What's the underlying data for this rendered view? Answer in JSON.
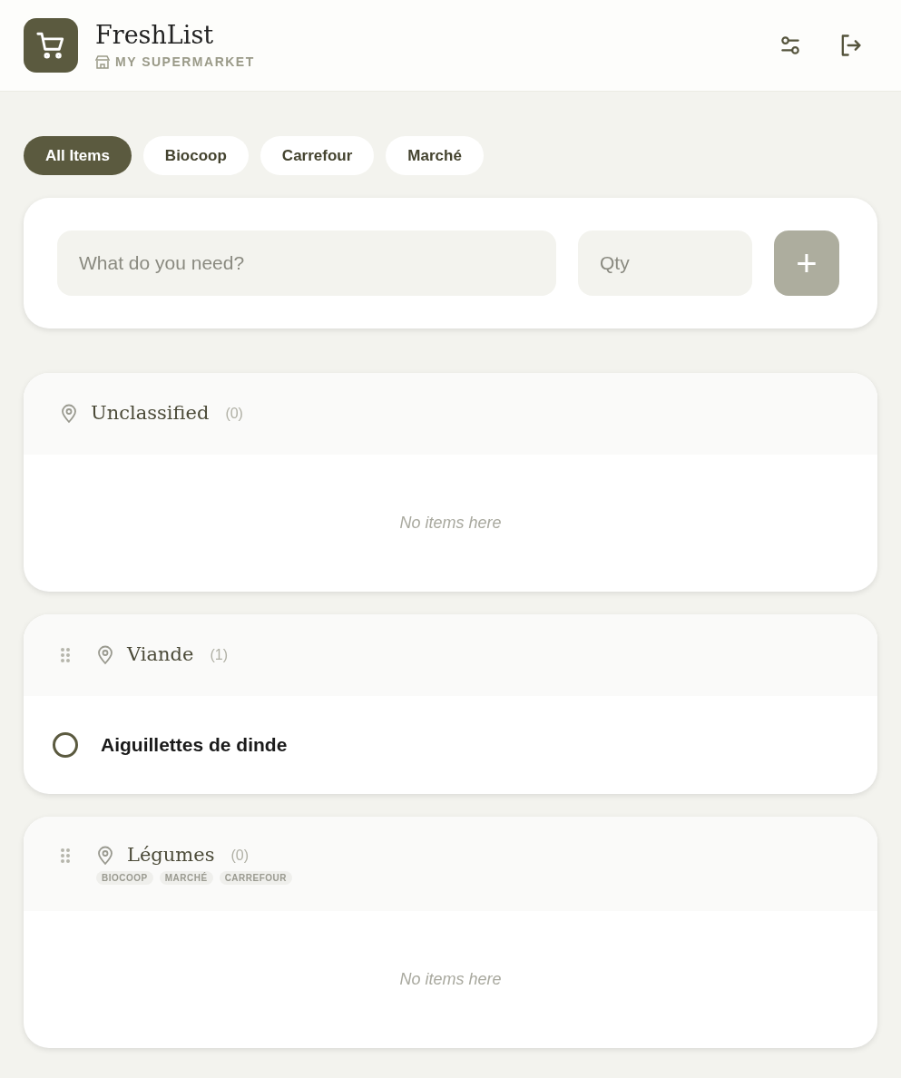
{
  "header": {
    "title": "FreshList",
    "subtitle": "MY SUPERMARKET"
  },
  "tabs": [
    {
      "label": "All Items",
      "selected": true
    },
    {
      "label": "Biocoop",
      "selected": false
    },
    {
      "label": "Carrefour",
      "selected": false
    },
    {
      "label": "Marché",
      "selected": false
    }
  ],
  "add_form": {
    "item": {
      "placeholder": "What do you need?"
    },
    "qty": {
      "placeholder": "Qty"
    },
    "add_button": "+"
  },
  "sections": [
    {
      "name": "Unclassified",
      "count": "(0)",
      "draggable": false,
      "empty_text": "No items here"
    },
    {
      "name": "Viande",
      "count": "(1)",
      "draggable": true,
      "items": [
        {
          "name": "Aiguillettes de dinde",
          "checked": false
        }
      ]
    },
    {
      "name": "Légumes",
      "count": "(0)",
      "draggable": true,
      "tags": [
        "BIOCOOP",
        "MARCHÉ",
        "CARREFOUR"
      ],
      "empty_text": "No items here"
    }
  ]
}
